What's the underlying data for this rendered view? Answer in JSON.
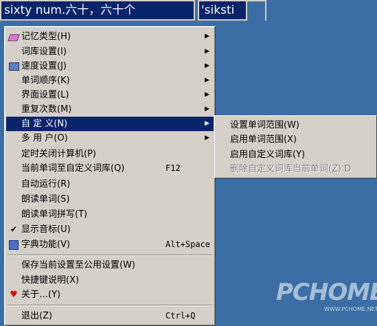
{
  "word_bar": {
    "word": "sixty  num.六十，六十个",
    "phonetic": "'siksti"
  },
  "menu": {
    "items": [
      {
        "label": "记忆类型(H)",
        "has_submenu": true,
        "icon": "gem-icon"
      },
      {
        "label": "词库设置(I)",
        "has_submenu": true
      },
      {
        "label": "速度设置(J)",
        "has_submenu": true,
        "icon": "film-icon"
      },
      {
        "label": "单词顺序(K)",
        "has_submenu": true
      },
      {
        "label": "界面设置(L)",
        "has_submenu": true
      },
      {
        "label": "重复次数(M)",
        "has_submenu": true
      },
      {
        "label": "自 定 义(N)",
        "has_submenu": true,
        "selected": true
      },
      {
        "label": "多 用 户(O)",
        "has_submenu": true
      },
      {
        "label": "定时关闭计算机(P)"
      },
      {
        "label": "当前单词至自定义词库(Q)",
        "accel": "F12"
      },
      {
        "label": "自动运行(R)"
      },
      {
        "label": "朗读单词(S)"
      },
      {
        "label": "朗读单词拼写(T)"
      },
      {
        "label": "显示音标(U)",
        "checked": true
      },
      {
        "label": "字典功能(V)",
        "accel": "Alt+Space",
        "icon": "book-icon"
      },
      {
        "label": "保存当前设置至公用设置(W)"
      },
      {
        "label": "快捷键说明(X)"
      },
      {
        "label": "关于…(Y)",
        "icon": "heart-icon"
      },
      {
        "label": "退出(Z)",
        "accel": "Ctrl+Q"
      }
    ]
  },
  "submenu": {
    "items": [
      {
        "label": "设置单词范围(W)"
      },
      {
        "label": "启用单词范围(X)"
      },
      {
        "label": "启用自定义词库(Y)"
      },
      {
        "label": "删除自定义词库当前单词(Z) D",
        "disabled": true
      }
    ]
  },
  "watermark": {
    "brand": "PCHOME",
    "url": "WWW.PCHOME.NET"
  },
  "colors": {
    "desktop": "#3a6ea5",
    "menu_bg": "#d4d0c8",
    "highlight": "#0a246a"
  }
}
